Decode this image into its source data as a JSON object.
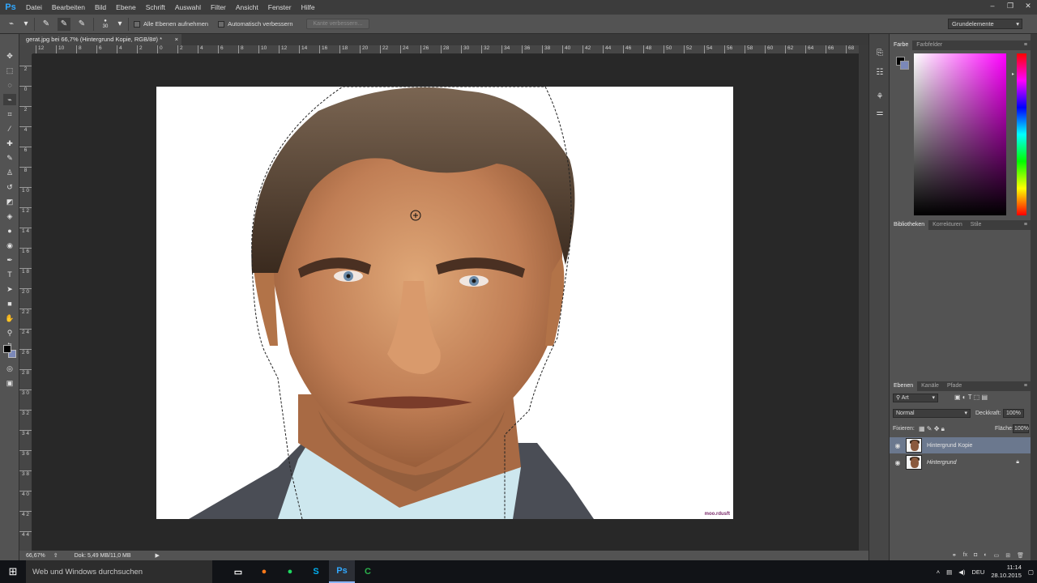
{
  "app": {
    "logo": "Ps"
  },
  "menu": [
    "Datei",
    "Bearbeiten",
    "Bild",
    "Ebene",
    "Schrift",
    "Auswahl",
    "Filter",
    "Ansicht",
    "Fenster",
    "Hilfe"
  ],
  "window_controls": {
    "minimize": "–",
    "restore": "❐",
    "close": "✕"
  },
  "options": {
    "brush_size": "30",
    "sample_all_layers": "Alle Ebenen aufnehmen",
    "auto_enhance": "Automatisch verbessern",
    "refine_edge": "Kante verbessern..."
  },
  "workspace": "Grundelemente",
  "document": {
    "tab_title": "gerat.jpg bei 66,7% (Hintergrund Kopie, RGB/8#) *",
    "tab_close": "×",
    "watermark": "moo.rdusft"
  },
  "rulers": {
    "h_ticks": [
      "12",
      "10",
      "8",
      "6",
      "4",
      "2",
      "0",
      "2",
      "4",
      "6",
      "8",
      "10",
      "12",
      "14",
      "16",
      "18",
      "20",
      "22",
      "24",
      "26",
      "28",
      "30",
      "32",
      "34",
      "36",
      "38",
      "40",
      "42",
      "44",
      "46",
      "48",
      "50",
      "52",
      "54",
      "56",
      "58",
      "60",
      "62",
      "64",
      "66",
      "68"
    ],
    "v_ticks": [
      "2",
      "0",
      "2",
      "4",
      "6",
      "8",
      "1 0",
      "1 2",
      "1 4",
      "1 6",
      "1 8",
      "2 0",
      "2 2",
      "2 4",
      "2 6",
      "2 8",
      "3 0",
      "3 2",
      "3 4",
      "3 6",
      "3 8",
      "4 0",
      "4 2",
      "4 4"
    ]
  },
  "status": {
    "zoom": "66,67%",
    "doc": "Dok: 5,49 MB/11,0 MB"
  },
  "color_panel": {
    "tabs": [
      "Farbe",
      "Farbfelder"
    ],
    "fg_color": "#000000",
    "bg_color": "#7b88b8"
  },
  "library_panel": {
    "tabs": [
      "Bibliotheken",
      "Korrekturen",
      "Stile"
    ]
  },
  "layers_panel": {
    "tabs": [
      "Ebenen",
      "Kanäle",
      "Pfade"
    ],
    "filter_kind": "Art",
    "blend_mode": "Normal",
    "opacity_label": "Deckkraft:",
    "opacity_value": "100%",
    "lock_label": "Fixieren:",
    "fill_label": "Fläche:",
    "fill_value": "100%",
    "layers": [
      {
        "name": "Hintergrund Kopie",
        "selected": true
      },
      {
        "name": "Hintergrund",
        "selected": false,
        "locked": true
      }
    ]
  },
  "taskbar": {
    "search_placeholder": "Web und Windows durchsuchen",
    "apps": [
      {
        "name": "task-view",
        "glyph": "▭",
        "color": "#ffffff"
      },
      {
        "name": "firefox",
        "glyph": "●",
        "color": "#ff7a1a"
      },
      {
        "name": "spotify",
        "glyph": "●",
        "color": "#1ed760"
      },
      {
        "name": "skype",
        "glyph": "S",
        "color": "#00aff0"
      },
      {
        "name": "photoshop",
        "glyph": "Ps",
        "color": "#31a8ff"
      },
      {
        "name": "camtasia",
        "glyph": "C",
        "color": "#2bb24c"
      }
    ],
    "language": "DEU",
    "time": "11:14",
    "date": "28.10.2015"
  }
}
